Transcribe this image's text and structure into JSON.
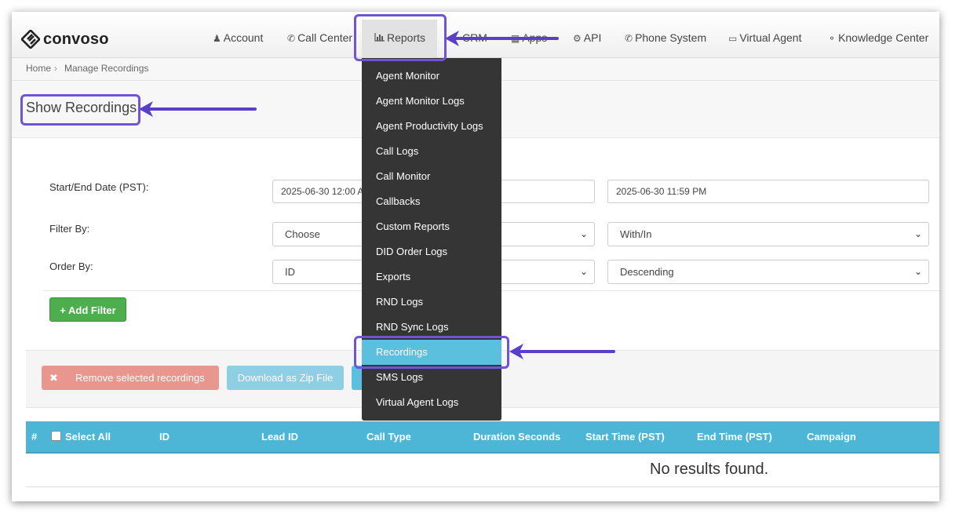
{
  "app": {
    "logo_text": "convoso"
  },
  "nav": {
    "items": [
      {
        "label": "Account",
        "icon": "user-icon"
      },
      {
        "label": "Call Center",
        "icon": "phone-icon"
      },
      {
        "label": "Reports",
        "icon": "bar-chart-icon",
        "active": true
      },
      {
        "label": "CRM",
        "icon": "crm-icon"
      },
      {
        "label": "Apps",
        "icon": "apps-grid-icon"
      },
      {
        "label": "API",
        "icon": "gear-icon"
      },
      {
        "label": "Phone System",
        "icon": "phone-icon"
      },
      {
        "label": "Virtual Agent",
        "icon": "monitor-icon"
      },
      {
        "label": "Knowledge Center",
        "icon": "lightbulb-icon"
      }
    ]
  },
  "breadcrumb": {
    "home": "Home",
    "separator": "›",
    "current": "Manage Recordings"
  },
  "page": {
    "title": "Show Recordings"
  },
  "form": {
    "date_label": "Start/End Date (PST):",
    "start_date": "2025-06-30 12:00 AM",
    "end_date": "2025-06-30 11:59 PM",
    "filter_label": "Filter By:",
    "filter_value": "Choose",
    "filter_operator": "With/In",
    "order_label": "Order By:",
    "order_value": "ID",
    "order_direction": "Descending",
    "add_filter_label": "+ Add Filter"
  },
  "actions": {
    "remove_icon": "✖",
    "remove_label": "Remove selected recordings",
    "download_label": "Download as Zip File"
  },
  "table": {
    "columns": [
      "#",
      "Select All",
      "ID",
      "Lead ID",
      "Call Type",
      "Duration Seconds",
      "Start Time (PST)",
      "End Time (PST)",
      "Campaign"
    ],
    "empty_message": "No results found."
  },
  "reports_menu": {
    "items": [
      "Agent Monitor",
      "Agent Monitor Logs",
      "Agent Productivity Logs",
      "Call Logs",
      "Call Monitor",
      "Callbacks",
      "Custom Reports",
      "DID Order Logs",
      "Exports",
      "RND Logs",
      "RND Sync Logs",
      "Recordings",
      "SMS Logs",
      "Virtual Agent Logs"
    ],
    "selected": "Recordings"
  },
  "colors": {
    "accent": "#5bc0de",
    "highlight": "#7153d8",
    "table_header": "#4db5d6",
    "success": "#4cae4c",
    "danger": "#e9968f",
    "menu_bg": "#353535"
  }
}
